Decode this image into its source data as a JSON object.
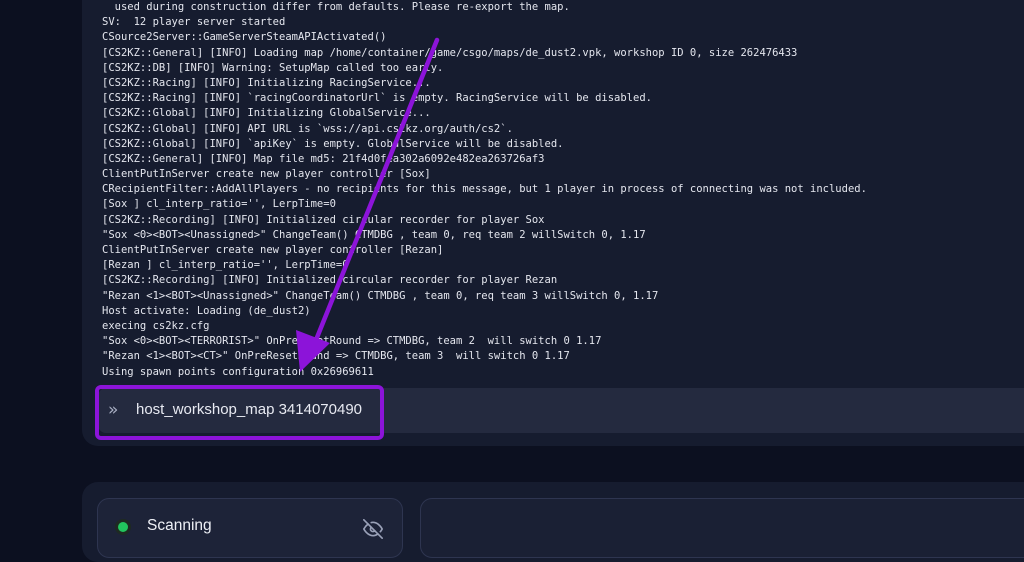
{
  "console": {
    "lines": [
      "  used during construction differ from defaults. Please re-export the map.",
      "SV:  12 player server started",
      "CSource2Server::GameServerSteamAPIActivated()",
      "[CS2KZ::General] [INFO] Loading map /home/container/game/csgo/maps/de_dust2.vpk, workshop ID 0, size 262476433",
      "[CS2KZ::DB] [INFO] Warning: SetupMap called too early.",
      "[CS2KZ::Racing] [INFO] Initializing RacingService...",
      "[CS2KZ::Racing] [INFO] `racingCoordinatorUrl` is empty. RacingService will be disabled.",
      "[CS2KZ::Global] [INFO] Initializing GlobalService...",
      "[CS2KZ::Global] [INFO] API URL is `wss://api.cs2kz.org/auth/cs2`.",
      "[CS2KZ::Global] [INFO] `apiKey` is empty. GlobalService will be disabled.",
      "[CS2KZ::General] [INFO] Map file md5: 21f4d0fea302a6092e482ea263726af3",
      "ClientPutInServer create new player controller [Sox]",
      "CRecipientFilter::AddAllPlayers - no recipients for this message, but 1 player in process of connecting was not included.",
      "[Sox ] cl_interp_ratio='', LerpTime=0",
      "[CS2KZ::Recording] [INFO] Initialized circular recorder for player Sox",
      "\"Sox <0><BOT><Unassigned>\" ChangeTeam() CTMDBG , team 0, req team 2 willSwitch 0, 1.17",
      "ClientPutInServer create new player controller [Rezan]",
      "[Rezan ] cl_interp_ratio='', LerpTime=0",
      "[CS2KZ::Recording] [INFO] Initialized circular recorder for player Rezan",
      "\"Rezan <1><BOT><Unassigned>\" ChangeTeam() CTMDBG , team 0, req team 3 willSwitch 0, 1.17",
      "Host activate: Loading (de_dust2)",
      "execing cs2kz.cfg",
      "\"Sox <0><BOT><TERRORIST>\" OnPreResetRound => CTMDBG, team 2  will switch 0 1.17",
      "\"Rezan <1><BOT><CT>\" OnPreResetRound => CTMDBG, team 3  will switch 0 1.17",
      "Using spawn points configuration 0x26969611"
    ]
  },
  "command_input": {
    "prompt_icon": "chevrons-right-icon",
    "value": "host_workshop_map 3414070490"
  },
  "status": {
    "label": "Scanning",
    "dot_color": "#22c55e",
    "toggle_icon": "eye-off-icon"
  },
  "annotation": {
    "color": "#8c14d9"
  }
}
